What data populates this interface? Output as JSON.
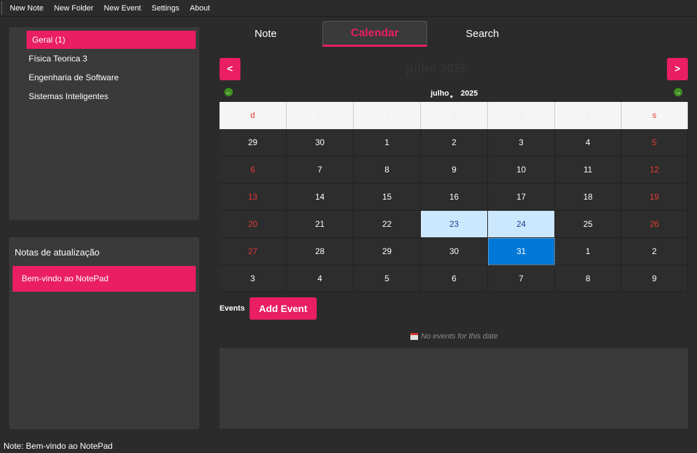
{
  "menu": [
    "New Note",
    "New Folder",
    "New Event",
    "Settings",
    "About"
  ],
  "folders": [
    "Geral (1)",
    "Física Teorica 3",
    "Engenharia de Software",
    "Sistemas Inteligentes"
  ],
  "notes_panel": {
    "title": "Notas de atualização",
    "items": [
      "Bem-vindo ao NotePad"
    ]
  },
  "tabs": [
    "Note",
    "Calendar",
    "Search"
  ],
  "calendar": {
    "prev_label": "<",
    "next_label": ">",
    "month_title": "julho 2025",
    "month_select": "julho",
    "year_select": "2025",
    "weekday_headers": [
      "d",
      "s",
      "t",
      "q",
      "q",
      "s",
      "s"
    ],
    "weeks": [
      [
        "29",
        "30",
        "1",
        "2",
        "3",
        "4",
        "5"
      ],
      [
        "6",
        "7",
        "8",
        "9",
        "10",
        "11",
        "12"
      ],
      [
        "13",
        "14",
        "15",
        "16",
        "17",
        "18",
        "19"
      ],
      [
        "20",
        "21",
        "22",
        "23",
        "24",
        "25",
        "26"
      ],
      [
        "27",
        "28",
        "29",
        "30",
        "31",
        "1",
        "2"
      ],
      [
        "3",
        "4",
        "5",
        "6",
        "7",
        "8",
        "9"
      ]
    ],
    "highlighted_days": [
      "23",
      "24"
    ],
    "selected_day": "31"
  },
  "events": {
    "label": "Events",
    "add_button": "Add Event",
    "empty_text": "No events for this date"
  },
  "status_bar": "Note: Bem-vindo ao NotePad",
  "colors": {
    "accent": "#e91e63",
    "weekend": "#e53935",
    "selected_day": "#0078d7",
    "highlight_day": "#cce8ff"
  }
}
